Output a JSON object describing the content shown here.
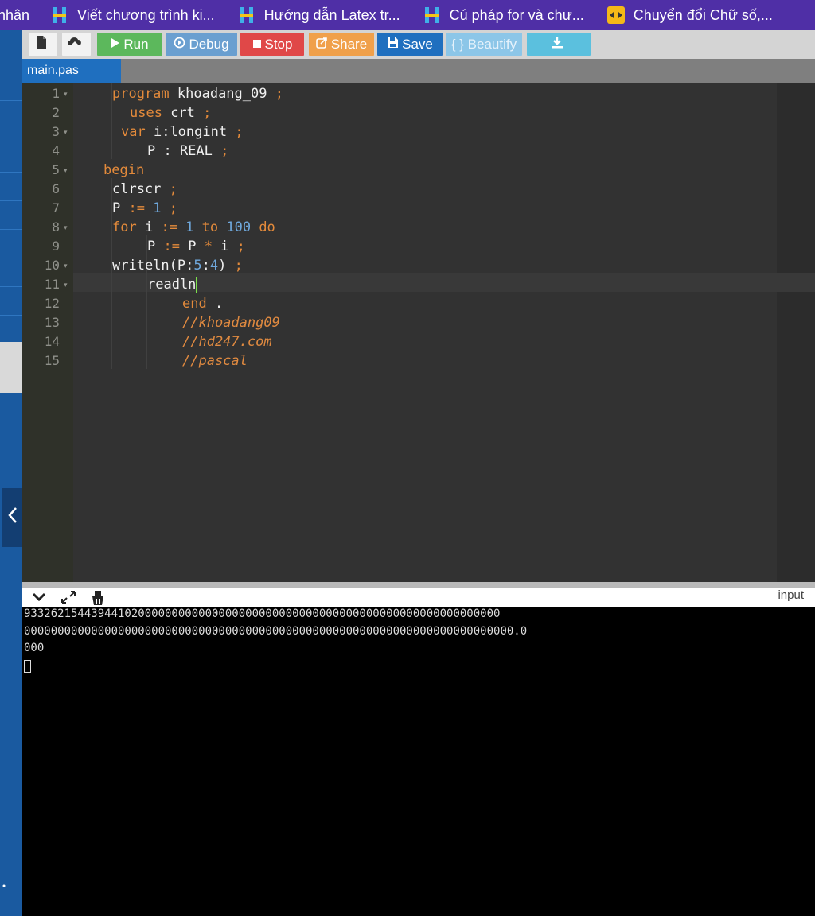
{
  "bookmarks": [
    {
      "label": "nhân",
      "icon": "none"
    },
    {
      "label": "Viết chương trình ki...",
      "icon": "hoc247-icon"
    },
    {
      "label": "Hướng dẫn Latex tr...",
      "icon": "hoc247-icon"
    },
    {
      "label": "Cú pháp for và chư...",
      "icon": "hoc247-icon"
    },
    {
      "label": "Chuyển đổi Chữ số,...",
      "icon": "convert-icon"
    }
  ],
  "toolbar": {
    "run": "Run",
    "debug": "Debug",
    "stop": "Stop",
    "share": "Share",
    "save": "Save",
    "beautify": "{ } Beautify"
  },
  "tab": {
    "name": "main.pas"
  },
  "editor": {
    "line_numbers": [
      "1",
      "2",
      "3",
      "4",
      "5",
      "6",
      "7",
      "8",
      "9",
      "10",
      "11",
      "12",
      "13",
      "14",
      "15"
    ],
    "lines": {
      "l1": {
        "kw": "program",
        "name": " khoadang_09",
        "end": " ;"
      },
      "l2": {
        "kw": "uses",
        "name": " crt",
        "end": " ;"
      },
      "l3": {
        "kw": "var",
        "name": " i:longint",
        "end": " ;"
      },
      "l4": {
        "name": "P : REAL",
        "end": " ;"
      },
      "l5": {
        "kw": "begin"
      },
      "l6": {
        "name": "clrscr",
        "end": " ;"
      },
      "l7": {
        "name": "P",
        "op": " := ",
        "num": "1",
        "end": " ;"
      },
      "l8": {
        "kw": "for",
        "name": " i",
        "op": " := ",
        "num1": "1",
        "kw2": " to ",
        "num2": "100",
        "kw3": " do"
      },
      "l9": {
        "name": "P",
        "op": " := ",
        "name2": "P",
        "op2": " * ",
        "name3": "i",
        "end": " ;"
      },
      "l10": {
        "name": "writeln(P:",
        "num1": "5",
        "sep": ":",
        "num2": "4",
        "close": ")",
        "end": " ;"
      },
      "l11": {
        "name": "readln"
      },
      "l12": {
        "kw": "end",
        "name": " ."
      },
      "l13": {
        "comment": "//khoadang09"
      },
      "l14": {
        "comment": "//hd247.com"
      },
      "l15": {
        "comment": "//pascal"
      }
    }
  },
  "console": {
    "input_label": "input",
    "output_lines": [
      "93326215443944102000000000000000000000000000000000000000000000000000000",
      "0000000000000000000000000000000000000000000000000000000000000000000000000.0",
      "000"
    ]
  },
  "colors": {
    "bookmarks_bg": "#4f2fa6",
    "run": "#5cb85c",
    "debug": "#6a9fd0",
    "stop": "#e04848",
    "share": "#f0a04a",
    "save": "#1f6fbf",
    "beautify": "#8cc6e8",
    "download": "#5bc0de"
  }
}
